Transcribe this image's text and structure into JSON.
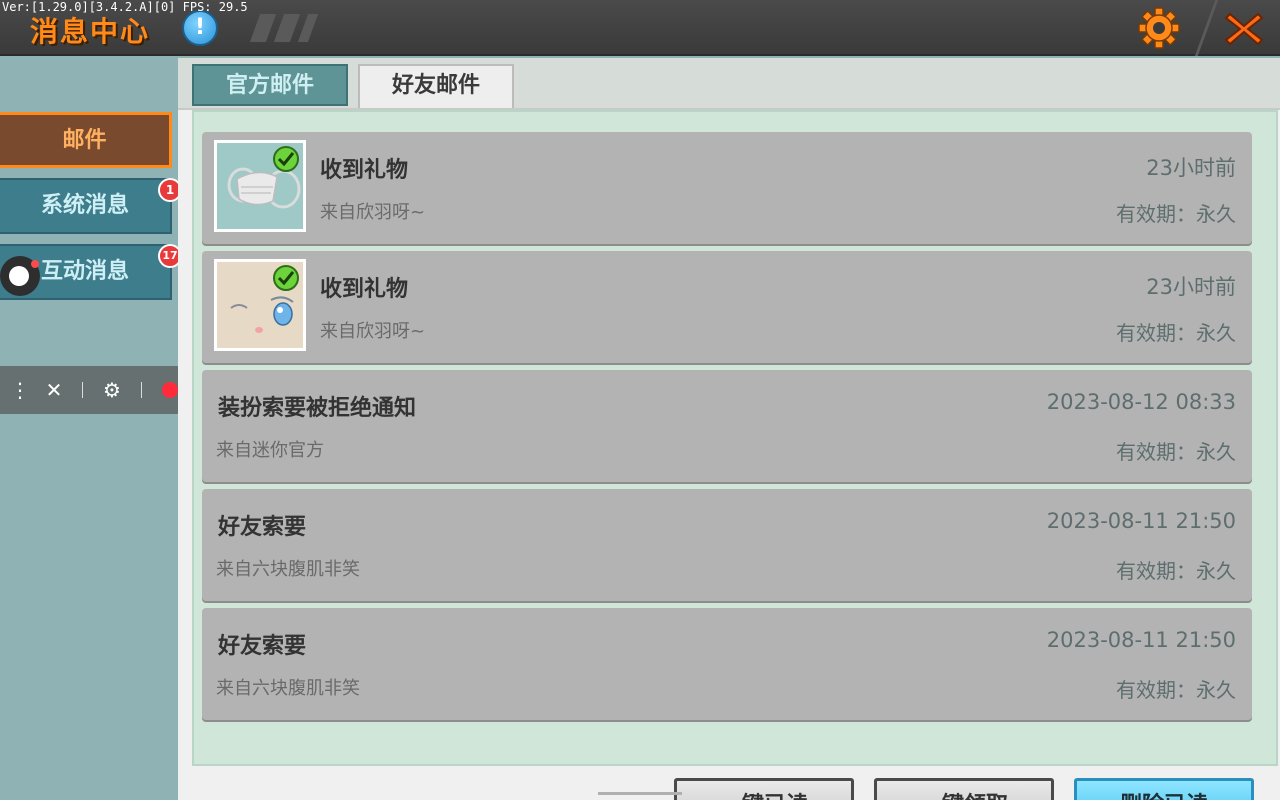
{
  "header": {
    "version_text": "Ver:[1.29.0][3.4.2.A][0] FPS: 29.5",
    "title": "消息中心",
    "info_icon": "!"
  },
  "sidebar": {
    "items": [
      {
        "label": "邮件",
        "active": true,
        "badge": ""
      },
      {
        "label": "系统消息",
        "active": false,
        "badge": "1"
      },
      {
        "label": "互动消息",
        "active": false,
        "badge": "17"
      }
    ]
  },
  "tabs": [
    {
      "label": "官方邮件",
      "active": false
    },
    {
      "label": "好友邮件",
      "active": true
    }
  ],
  "messages": [
    {
      "title": "收到礼物",
      "from": "来自欣羽呀~",
      "time": "23小时前",
      "valid": "有效期：永久",
      "thumb": "mask-gift-icon",
      "claimed": true
    },
    {
      "title": "收到礼物",
      "from": "来自欣羽呀~",
      "time": "23小时前",
      "valid": "有效期：永久",
      "thumb": "face-gift-icon",
      "claimed": true
    },
    {
      "title": "装扮索要被拒绝通知",
      "from": "来自迷你官方",
      "time": "2023-08-12 08:33",
      "valid": "有效期：永久"
    },
    {
      "title": "好友索要",
      "from": "来自六块腹肌非笑",
      "time": "2023-08-11 21:50",
      "valid": "有效期：永久"
    },
    {
      "title": "好友索要",
      "from": "来自六块腹肌非笑",
      "time": "2023-08-11 21:50",
      "valid": "有效期：永久"
    }
  ],
  "actions": {
    "read_all": "一键已读",
    "claim_all": "一键领取",
    "delete_read": "删除已读"
  },
  "colors": {
    "accent_orange": "#ff8a1a",
    "sidebar_teal": "#3e7d8c",
    "primary_button": "#41bfee",
    "badge_red": "#e83a3a"
  }
}
